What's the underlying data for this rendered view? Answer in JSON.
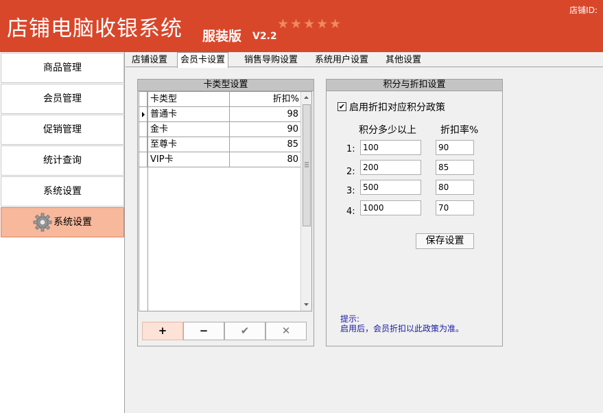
{
  "header": {
    "title": "店铺电脑收银系统",
    "edition": "服装版",
    "version": "V2.2",
    "stars": "★★★★★",
    "store_id_label": "店铺ID:"
  },
  "sidebar": {
    "items": [
      {
        "label": "商品管理"
      },
      {
        "label": "会员管理"
      },
      {
        "label": "促销管理"
      },
      {
        "label": "统计查询"
      },
      {
        "label": "系统设置"
      },
      {
        "label": "系统设置"
      }
    ]
  },
  "tabs": [
    {
      "label": "店铺设置"
    },
    {
      "label": "会员卡设置"
    },
    {
      "label": "销售导购设置"
    },
    {
      "label": "系统用户设置"
    },
    {
      "label": "其他设置"
    }
  ],
  "card_panel": {
    "title": "卡类型设置",
    "columns": [
      "卡类型",
      "折扣%"
    ],
    "rows": [
      {
        "name": "普通卡",
        "discount": "98"
      },
      {
        "name": "金卡",
        "discount": "90"
      },
      {
        "name": "至尊卡",
        "discount": "85"
      },
      {
        "name": "VIP卡",
        "discount": "80"
      }
    ],
    "buttons": {
      "add": "+",
      "remove": "−",
      "confirm": "✔",
      "cancel": "✕"
    }
  },
  "points_panel": {
    "title": "积分与折扣设置",
    "checkbox_label": "启用折扣对应积分政策",
    "checked": true,
    "col_points": "积分多少以上",
    "col_rate": "折扣率%",
    "rows": [
      {
        "index": "1:",
        "points": "100",
        "rate": "90"
      },
      {
        "index": "2:",
        "points": "200",
        "rate": "85"
      },
      {
        "index": "3:",
        "points": "500",
        "rate": "80"
      },
      {
        "index": "4:",
        "points": "1000",
        "rate": "70"
      }
    ],
    "save_label": "保存设置",
    "hint_title": "提示:",
    "hint_text": "启用后，会员折扣以此政策为准。"
  },
  "colors": {
    "header_bg": "#d9472b",
    "active_side": "#f7b89c",
    "hint": "#1a1aa0"
  }
}
